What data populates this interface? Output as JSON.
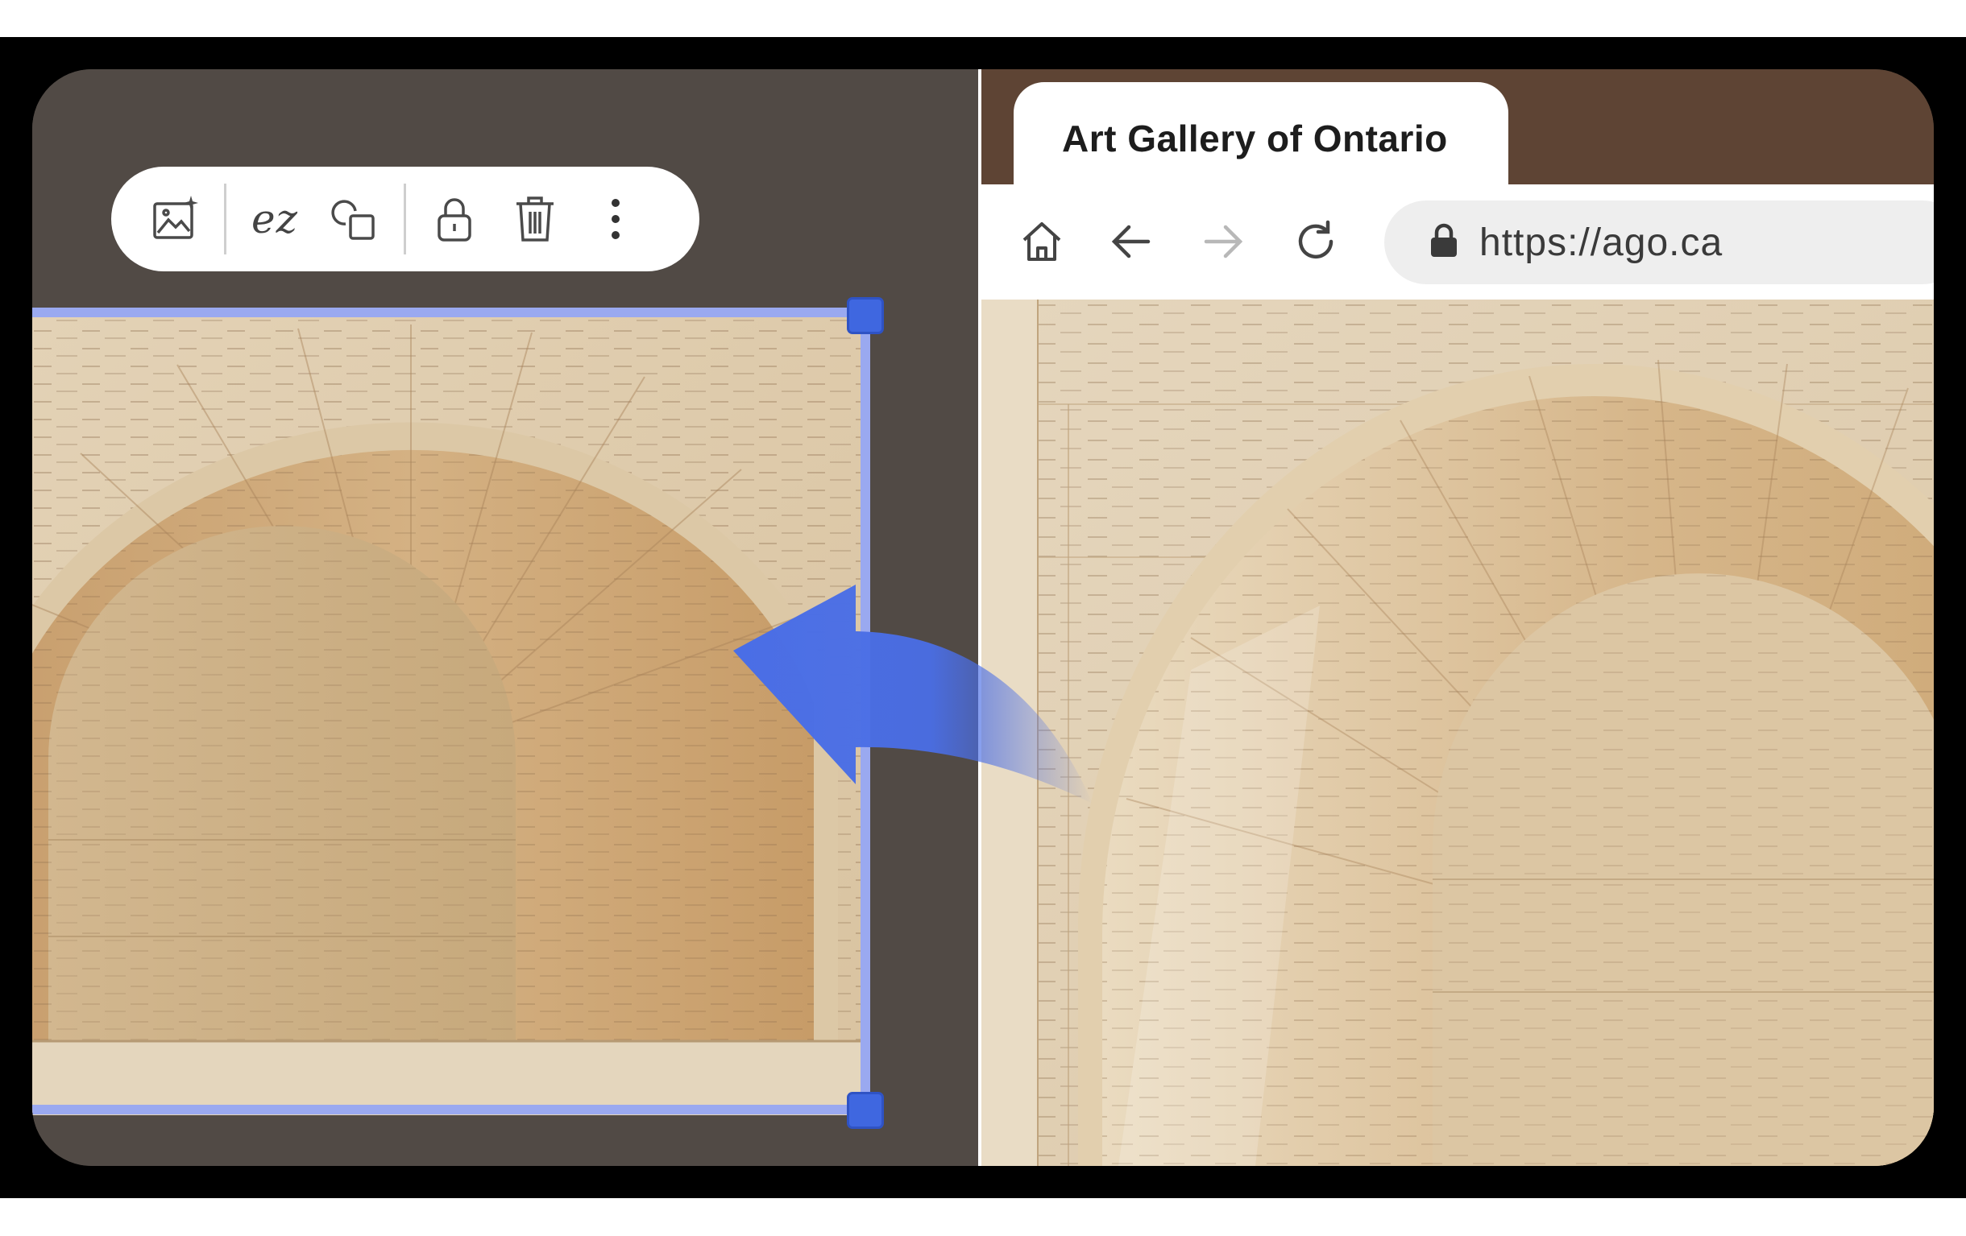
{
  "browser": {
    "tab_title": "Art Gallery of Ontario",
    "url": "https://ago.ca"
  },
  "toolbar": {
    "icons": [
      "image-sparkle-icon",
      "ez-logo",
      "copy-shapes-icon",
      "lock-icon",
      "trash-icon",
      "more-vertical-icon"
    ],
    "ez_label": "ez"
  },
  "colors": {
    "editor_background": "#514a45",
    "browser_tab_strip": "#5e4434",
    "selection_border": "#9aa9f0",
    "selection_handle": "#3f67e0",
    "arrow": "#4a6ee6"
  }
}
